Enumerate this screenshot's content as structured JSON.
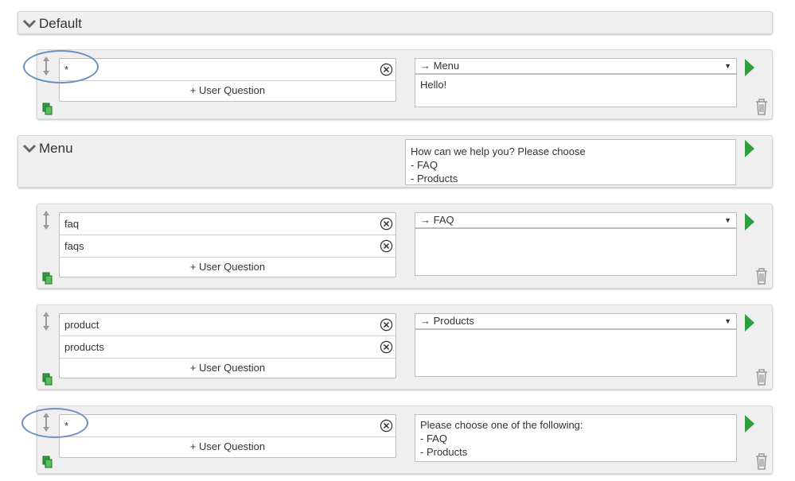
{
  "groups": [
    {
      "title": "Default"
    },
    {
      "title": "Menu",
      "response": "How can we help you? Please choose\n- FAQ\n- Products"
    }
  ],
  "add_question_label": "+ User Question",
  "rules": [
    {
      "questions": [
        "*"
      ],
      "target": "→ Menu",
      "response": "Hello!"
    },
    {
      "questions": [
        "faq",
        "faqs"
      ],
      "target": "→ FAQ",
      "response": ""
    },
    {
      "questions": [
        "product",
        "products"
      ],
      "target": "→ Products",
      "response": ""
    },
    {
      "questions": [
        "*"
      ],
      "target": "",
      "response": "Please choose one of the following:\n- FAQ\n- Products"
    }
  ],
  "colors": {
    "play": "#2e9e3e",
    "annotation": "#6b8fbf",
    "header_bg": "#efefef"
  }
}
